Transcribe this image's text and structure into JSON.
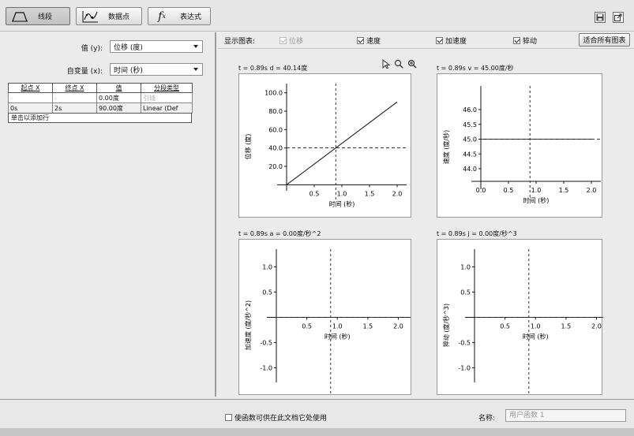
{
  "toolbar": {
    "buttons": [
      {
        "label": "线段",
        "icon": "segment-curve-icon",
        "active": true
      },
      {
        "label": "数据点",
        "icon": "data-points-icon",
        "active": false
      },
      {
        "label": "表达式",
        "icon": "function-fx-icon",
        "active": false
      }
    ],
    "right_icons": [
      "save-icon",
      "export-icon"
    ]
  },
  "left": {
    "value_label": "值 (y):",
    "value_selected": "位移 (度)",
    "indep_label": "自变量 (x):",
    "indep_selected": "时间 (秒)",
    "table": {
      "headers": [
        "起点 X",
        "终点 X",
        "值",
        "分段类型"
      ],
      "rows": [
        [
          "-",
          "-",
          "0.00度",
          "引线"
        ],
        [
          "0s",
          "2s",
          "90.00度",
          "Linear (Def"
        ]
      ],
      "add_row_hint": "单击以添加行"
    }
  },
  "right": {
    "show_label": "显示图表:",
    "checkboxes": [
      {
        "label": "位移",
        "checked": true,
        "disabled": true
      },
      {
        "label": "速度",
        "checked": true,
        "disabled": false
      },
      {
        "label": "加速度",
        "checked": true,
        "disabled": false
      },
      {
        "label": "猝动",
        "checked": true,
        "disabled": false
      }
    ],
    "fit_all_label": "适合所有图表",
    "charts": [
      {
        "readout": "t = 0.89s   d = 40.14度"
      },
      {
        "readout": "t = 0.89s   v = 45.00度/秒"
      },
      {
        "readout": "t = 0.89s   a = 0.00度/秒^2"
      },
      {
        "readout": "t = 0.89s   j = 0.00度/秒^3"
      }
    ]
  },
  "bottom": {
    "share_label": "使函数可供在此文档它处使用",
    "name_label": "名称:",
    "name_placeholder": "用户函数 1"
  },
  "chart_data": [
    {
      "type": "line",
      "xlabel": "时间 (秒)",
      "ylabel": "位移 (度)",
      "xlim": [
        0,
        2.2
      ],
      "ylim": [
        -10,
        110
      ],
      "xticks": [
        0.5,
        1.0,
        1.5,
        2.0
      ],
      "yticks": [
        20.0,
        40.0,
        60.0,
        80.0,
        100.0
      ],
      "series": [
        {
          "x": [
            0,
            2.0
          ],
          "y": [
            0,
            90
          ]
        }
      ],
      "cursor": {
        "x": 0.89,
        "y": 40.14
      }
    },
    {
      "type": "line",
      "xlabel": "时间 (秒)",
      "ylabel": "速度 (度/秒)",
      "xlim": [
        0,
        2.2
      ],
      "ylim": [
        43.2,
        46.8
      ],
      "xticks": [
        0.0,
        0.5,
        1.0,
        1.5,
        2.0
      ],
      "yticks": [
        44.0,
        44.5,
        45.0,
        45.5,
        46.0
      ],
      "series": [
        {
          "x": [
            0,
            2.0
          ],
          "y": [
            45,
            45
          ]
        }
      ],
      "cursor": {
        "x": 0.89,
        "y": 45.0
      }
    },
    {
      "type": "line",
      "xlabel": "时间 (秒)",
      "ylabel": "加速度 (度/秒^2)",
      "xlim": [
        0,
        2.2
      ],
      "ylim": [
        -1.35,
        1.35
      ],
      "xticks": [
        0.5,
        1.0,
        1.5,
        2.0
      ],
      "yticks": [
        -1.0,
        -0.5,
        0.5,
        1.0
      ],
      "series": [],
      "cursor": {
        "x": 0.89,
        "y": 0.0
      }
    },
    {
      "type": "line",
      "xlabel": "时间 (秒)",
      "ylabel": "猝动 (度/秒^3)",
      "xlim": [
        0,
        2.2
      ],
      "ylim": [
        -1.35,
        1.35
      ],
      "xticks": [
        0.5,
        1.0,
        1.5,
        2.0
      ],
      "yticks": [
        -1.0,
        -0.5,
        0.5,
        1.0
      ],
      "series": [],
      "cursor": {
        "x": 0.89,
        "y": 0.0
      }
    }
  ]
}
